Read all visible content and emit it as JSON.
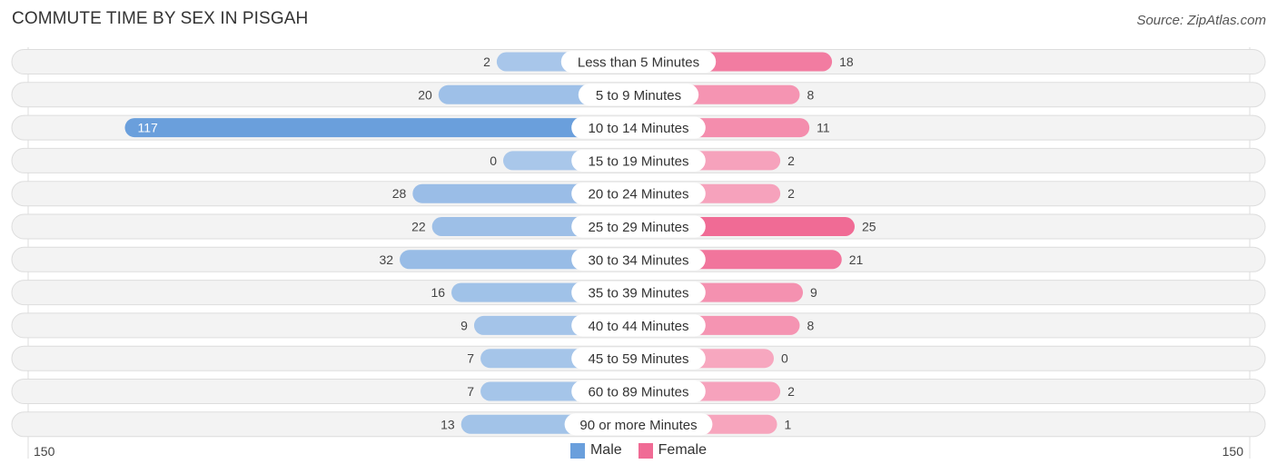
{
  "title": "COMMUTE TIME BY SEX IN PISGAH",
  "source": "Source: ZipAtlas.com",
  "colors": {
    "male": "#6a9fdc",
    "male_light": "#a9c7ea",
    "female": "#f06b95",
    "female_light": "#f7a7bf",
    "row_bg": "#f3f3f3",
    "row_border": "#dddddd"
  },
  "chart_data": {
    "type": "bar",
    "orientation": "horizontal-diverging",
    "title": "COMMUTE TIME BY SEX IN PISGAH",
    "categories": [
      "Less than 5 Minutes",
      "5 to 9 Minutes",
      "10 to 14 Minutes",
      "15 to 19 Minutes",
      "20 to 24 Minutes",
      "25 to 29 Minutes",
      "30 to 34 Minutes",
      "35 to 39 Minutes",
      "40 to 44 Minutes",
      "45 to 59 Minutes",
      "60 to 89 Minutes",
      "90 or more Minutes"
    ],
    "series": [
      {
        "name": "Male",
        "values": [
          2,
          20,
          117,
          0,
          28,
          22,
          32,
          16,
          9,
          7,
          7,
          13
        ]
      },
      {
        "name": "Female",
        "values": [
          18,
          8,
          11,
          2,
          2,
          25,
          21,
          9,
          8,
          0,
          2,
          1
        ]
      }
    ],
    "axis": {
      "left_label": "150",
      "right_label": "150",
      "range": [
        0,
        150
      ]
    },
    "legend": {
      "position": "bottom-center",
      "entries": [
        "Male",
        "Female"
      ]
    }
  }
}
